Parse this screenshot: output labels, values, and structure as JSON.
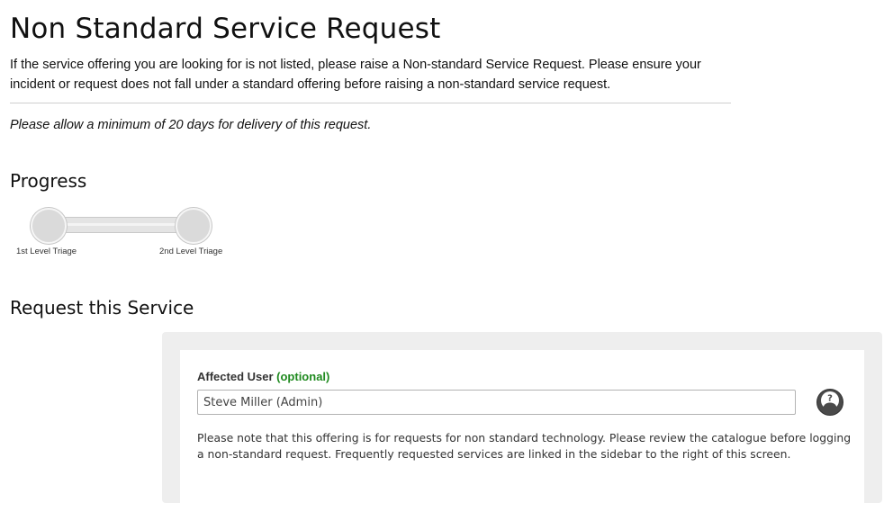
{
  "page": {
    "title": "Non Standard Service Request",
    "intro": "If the service offering you are looking for is not listed, please raise a Non-standard Service Request. Please ensure your incident or request does not fall under a standard offering before raising a non-standard service request.",
    "notice": "Please allow a minimum of 20 days for delivery of this request."
  },
  "progress": {
    "heading": "Progress",
    "stages": [
      {
        "label": "1st Level Triage"
      },
      {
        "label": "2nd Level Triage"
      }
    ]
  },
  "request": {
    "heading": "Request this Service",
    "affected_user": {
      "label": "Affected User",
      "optional_label": "(optional)",
      "value": "Steve Miller (Admin)",
      "help_icon": "help-person-icon"
    },
    "note": "Please note that this offering is for requests for non standard technology. Please review the catalogue before logging a non-standard request. Frequently requested services are linked in the sidebar to the right of this screen."
  },
  "colors": {
    "optional_text": "#1f8a1f",
    "panel_background": "#eeeeee",
    "tracker_node": "#dadada",
    "help_button": "#4a4a4a"
  }
}
